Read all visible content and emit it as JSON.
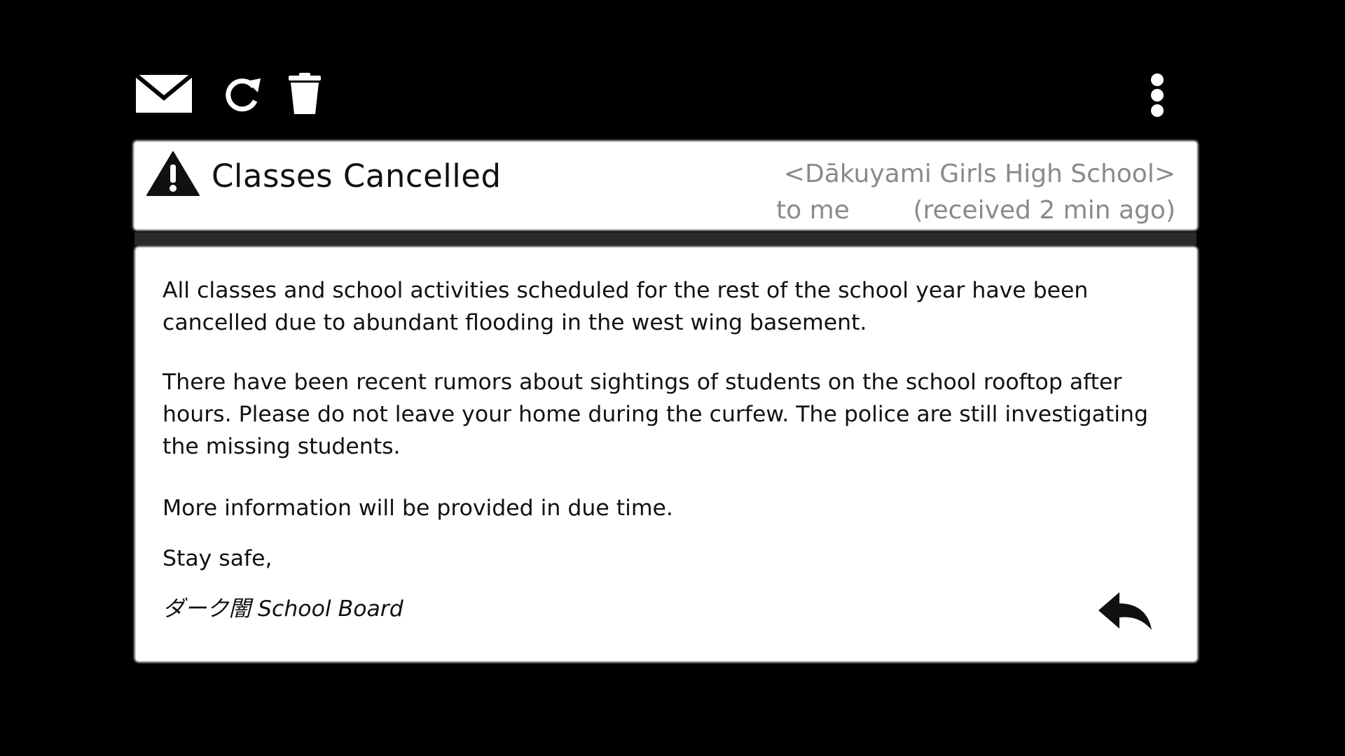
{
  "toolbar": {
    "icons": [
      "mail-icon",
      "refresh-icon",
      "trash-icon",
      "more-vertical-icon"
    ]
  },
  "email": {
    "subject": "Classes Cancelled",
    "sender": "<Dākuyami Girls High School>",
    "recipient": "to me",
    "received": "(received 2 min ago)",
    "body": {
      "paragraph_1": "All classes and school activities scheduled for the rest of the school year have been cancelled due to abundant flooding in the west wing basement.",
      "paragraph_2": "There have been recent rumors about sightings of students on the school rooftop after hours. Please do not leave your home during the curfew. The police are still investigating the missing students.",
      "paragraph_3": "More information will be provided in due time.",
      "closing": "Stay safe,",
      "signature": "ダーク闇 School Board"
    }
  },
  "icons": {
    "warning": "warning-icon",
    "reply": "reply-icon"
  },
  "colors": {
    "background": "#000000",
    "panel": "#ffffff",
    "text": "#111111",
    "meta_text": "#8a8a8a"
  }
}
